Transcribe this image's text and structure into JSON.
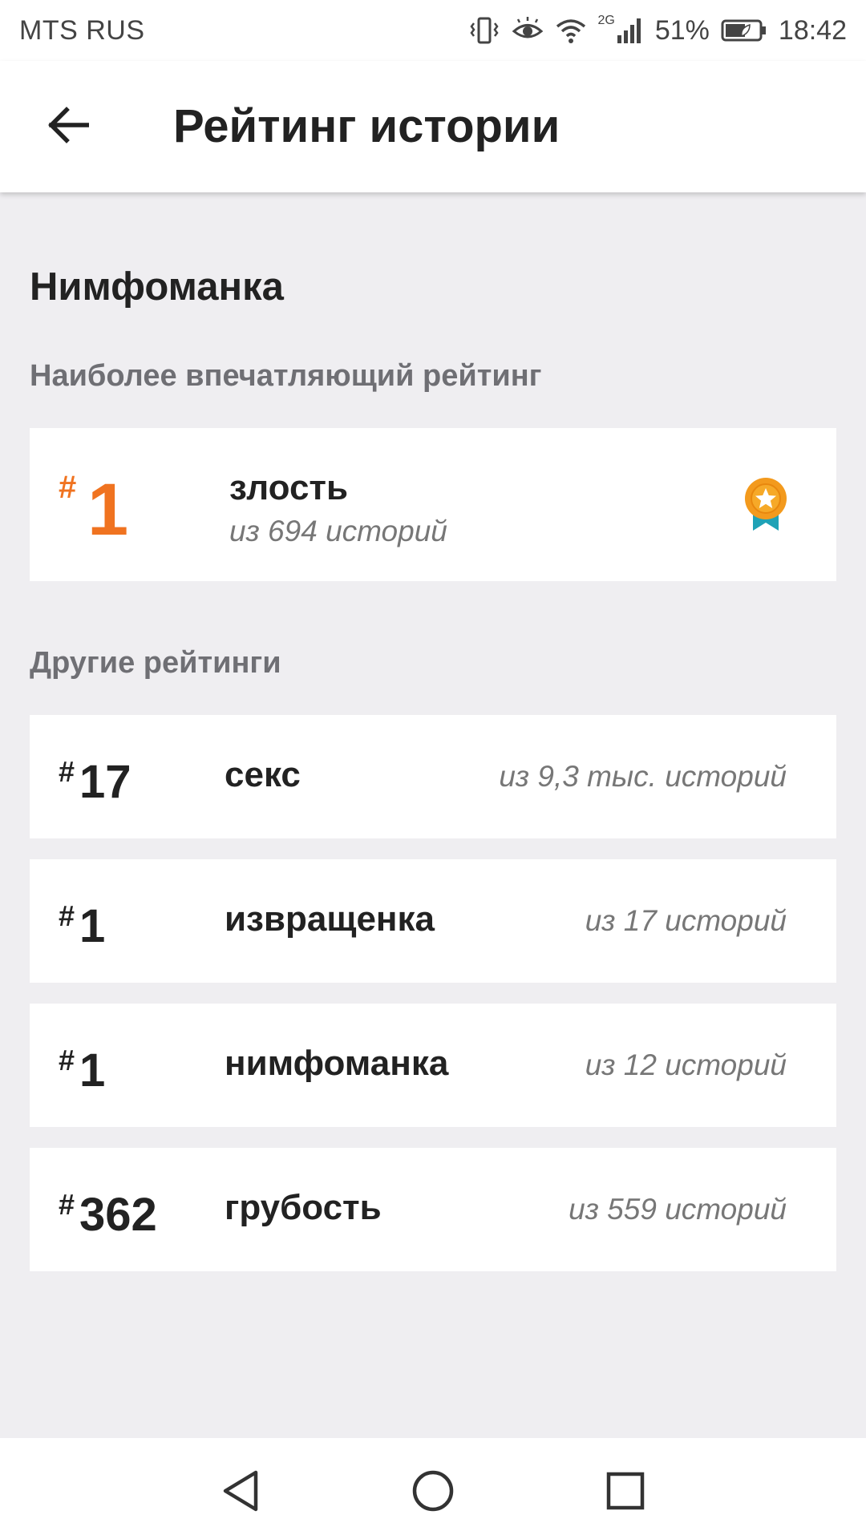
{
  "status_bar": {
    "carrier": "MTS RUS",
    "network": "2G",
    "battery": "51%",
    "time": "18:42",
    "icons": [
      "vibrate-icon",
      "eye-comfort-icon",
      "wifi-icon",
      "signal-icon",
      "battery-icon"
    ]
  },
  "app_bar": {
    "title": "Рейтинг истории",
    "back_icon": "arrow-left-icon"
  },
  "story": {
    "title": "Нимфоманка"
  },
  "top_section": {
    "label": "Наиболее впечатляющий рейтинг",
    "rank_hash": "#",
    "rank": "1",
    "tag": "злость",
    "subtitle": "из 694 историй",
    "badge_icon": "medal-star-icon",
    "accent_color": "#f07320"
  },
  "other_section": {
    "label": "Другие рейтинги",
    "items": [
      {
        "hash": "#",
        "rank": "17",
        "tag": "секс",
        "count": "из 9,3 тыс. историй"
      },
      {
        "hash": "#",
        "rank": "1",
        "tag": "извращенка",
        "count": "из 17 историй"
      },
      {
        "hash": "#",
        "rank": "1",
        "tag": "нимфоманка",
        "count": "из 12 историй"
      },
      {
        "hash": "#",
        "rank": "362",
        "tag": "грубость",
        "count": "из 559 историй"
      }
    ]
  },
  "nav_bar": {
    "icons": [
      "nav-back-icon",
      "nav-home-icon",
      "nav-recents-icon"
    ]
  }
}
